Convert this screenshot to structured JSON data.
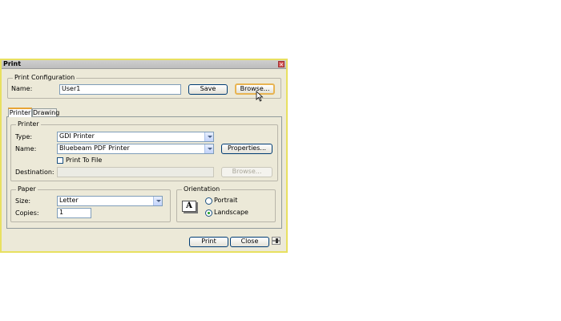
{
  "window": {
    "title": "Print"
  },
  "print_config": {
    "legend": "Print Configuration",
    "name_label": "Name:",
    "name_value": "User1",
    "save_label": "Save",
    "browse_label": "Browse..."
  },
  "tabs": [
    {
      "label": "Printer"
    },
    {
      "label": "Drawing"
    }
  ],
  "printer": {
    "legend": "Printer",
    "type_label": "Type:",
    "type_value": "GDI Printer",
    "name_label": "Name:",
    "name_value": "Bluebeam PDF Printer",
    "properties_label": "Properties...",
    "print_to_file_label": "Print To File",
    "print_to_file_checked": false,
    "destination_label": "Destination:",
    "destination_value": "",
    "browse_label": "Browse..."
  },
  "paper": {
    "legend": "Paper",
    "size_label": "Size:",
    "size_value": "Letter",
    "copies_label": "Copies:",
    "copies_value": "1"
  },
  "orientation": {
    "legend": "Orientation",
    "icon_letter": "A",
    "portrait_label": "Portrait",
    "landscape_label": "Landscape",
    "selected": "Landscape"
  },
  "footer": {
    "print_label": "Print",
    "close_label": "Close"
  }
}
